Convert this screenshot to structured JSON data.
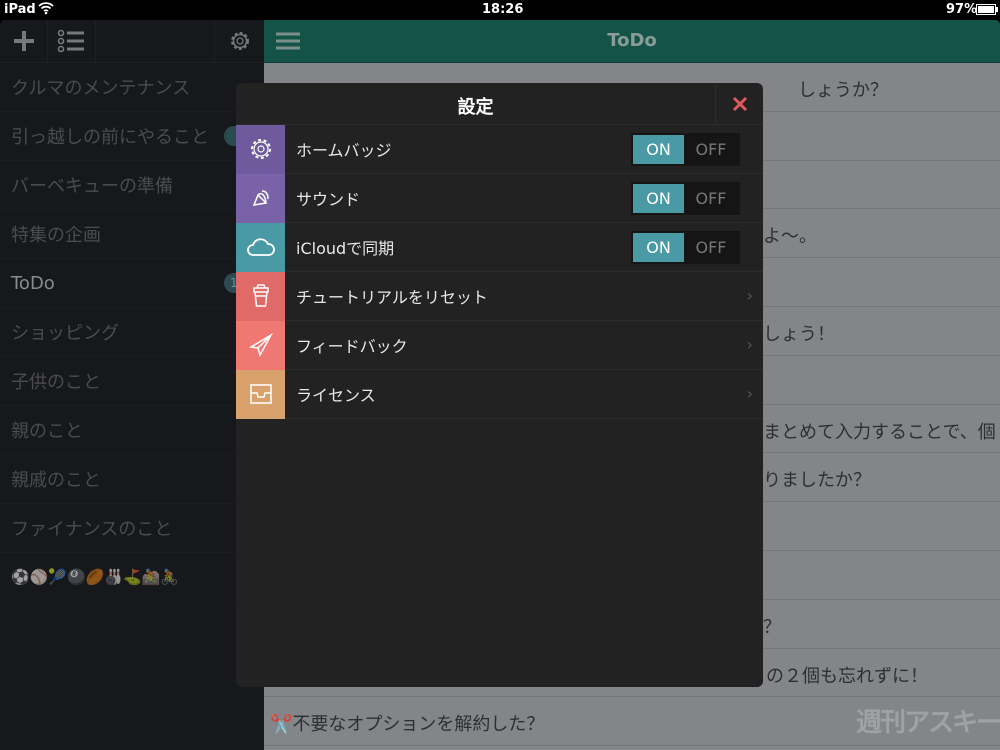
{
  "status_bar": {
    "device": "iPad",
    "time": "18:26",
    "battery": "97%"
  },
  "sidebar": {
    "items": [
      {
        "label": "クルマのメンテナンス"
      },
      {
        "label": "引っ越しの前にやること",
        "badge": ""
      },
      {
        "label": "バーベキューの準備"
      },
      {
        "label": "特集の企画"
      },
      {
        "label": "ToDo",
        "badge": "1",
        "active": true
      },
      {
        "label": "ショッピング"
      },
      {
        "label": "子供のこと"
      },
      {
        "label": "親のこと"
      },
      {
        "label": "親戚のこと"
      },
      {
        "label": "ファイナンスのこと"
      },
      {
        "label": "⚽⚾🎾🎱🏉🎳⛳🚵🚴"
      }
    ]
  },
  "main": {
    "title": "ToDo",
    "rows": [
      "しょうか？",
      "",
      "",
      "よ〜。",
      "",
      "しょう！",
      "",
      "まとめて入力することで、個",
      "りましたか？",
      "",
      "",
      "？",
      "の２個も忘れずに！",
      "✂️不要なオプションを解約した？"
    ],
    "watermark": "週刊アスキー"
  },
  "dialog": {
    "title": "設定",
    "items": [
      {
        "label": "ホームバッジ",
        "icon": "gear-icon",
        "color": "#6e5a9c",
        "toggle": {
          "on": "ON",
          "off": "OFF",
          "value": true
        }
      },
      {
        "label": "サウンド",
        "icon": "speaker-icon",
        "color": "#7a62a8",
        "toggle": {
          "on": "ON",
          "off": "OFF",
          "value": true
        }
      },
      {
        "label": "iCloudで同期",
        "icon": "cloud-icon",
        "color": "#4a9aa6",
        "toggle": {
          "on": "ON",
          "off": "OFF",
          "value": true
        }
      },
      {
        "label": "チュートリアルをリセット",
        "icon": "cup-icon",
        "color": "#e06a68"
      },
      {
        "label": "フィードバック",
        "icon": "paper-plane-icon",
        "color": "#ef7873"
      },
      {
        "label": "ライセンス",
        "icon": "inbox-icon",
        "color": "#d9a26c"
      }
    ],
    "close_color": "#e05a5a"
  }
}
